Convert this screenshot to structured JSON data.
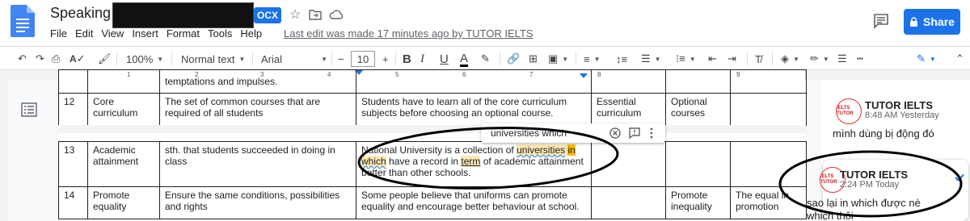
{
  "header": {
    "title": "Speaking –",
    "format_badge": "OCX",
    "menu": [
      "File",
      "Edit",
      "View",
      "Insert",
      "Format",
      "Tools",
      "Help"
    ],
    "last_edit": "Last edit was made 17 minutes ago by TUTOR IELTS",
    "share_label": "Share"
  },
  "toolbar": {
    "zoom": "100%",
    "style": "Normal text",
    "font": "Arial",
    "font_size": "10",
    "minus": "−",
    "plus": "+"
  },
  "ruler": {
    "numbers": [
      "1",
      "2",
      "3",
      "4",
      "5",
      "6",
      "7",
      "8",
      "9"
    ]
  },
  "table": {
    "top_partial": "temptations and impulses.",
    "rows": [
      {
        "num": "12",
        "term": "Core curriculum",
        "definition": "The set of common courses that are required of all students",
        "example": "Students have to learn all of the core curriculum subjects before choosing an optional course.",
        "col5": "Essential curriculum",
        "col6": "Optional courses",
        "col7": ""
      },
      {
        "num": "13",
        "term": "Academic attainment",
        "definition": "sth. that students succeeded in doing in class",
        "example_a": "National University is a collection of ",
        "example_b": "universities",
        "example_c": " ",
        "example_d": "in",
        "example_e": "which",
        "example_f": " have a record in ",
        "example_g": "term",
        "example_h": " of academic attainment better than other schools.",
        "col5": "",
        "col6": "",
        "col7": ""
      },
      {
        "num": "14",
        "term": "Promote equality",
        "definition": "Ensure the same conditions, possibilities and rights",
        "example": "Some people believe that uniforms can promote equality and encourage better behaviour at school.",
        "col5": "",
        "col6": "Promote inequality",
        "col7": "The equal in promotion"
      }
    ]
  },
  "suggestion_tooltip": {
    "text": "universities which"
  },
  "comments": [
    {
      "author": "TUTOR IELTS",
      "time": "8:48 AM Yesterday",
      "body": "mình dùng bị động đó",
      "avatar_text": "IELTS TUTOR"
    },
    {
      "author": "TUTOR IELTS",
      "time": "2:24 PM Today",
      "body": "sao lại in which được nè",
      "body2": "which thôi",
      "avatar_text": "IELTS TUTOR"
    }
  ],
  "colors": {
    "accent": "#1a73e8",
    "highlight": "#fce8b2",
    "highlight_strong": "#fbbc04"
  }
}
